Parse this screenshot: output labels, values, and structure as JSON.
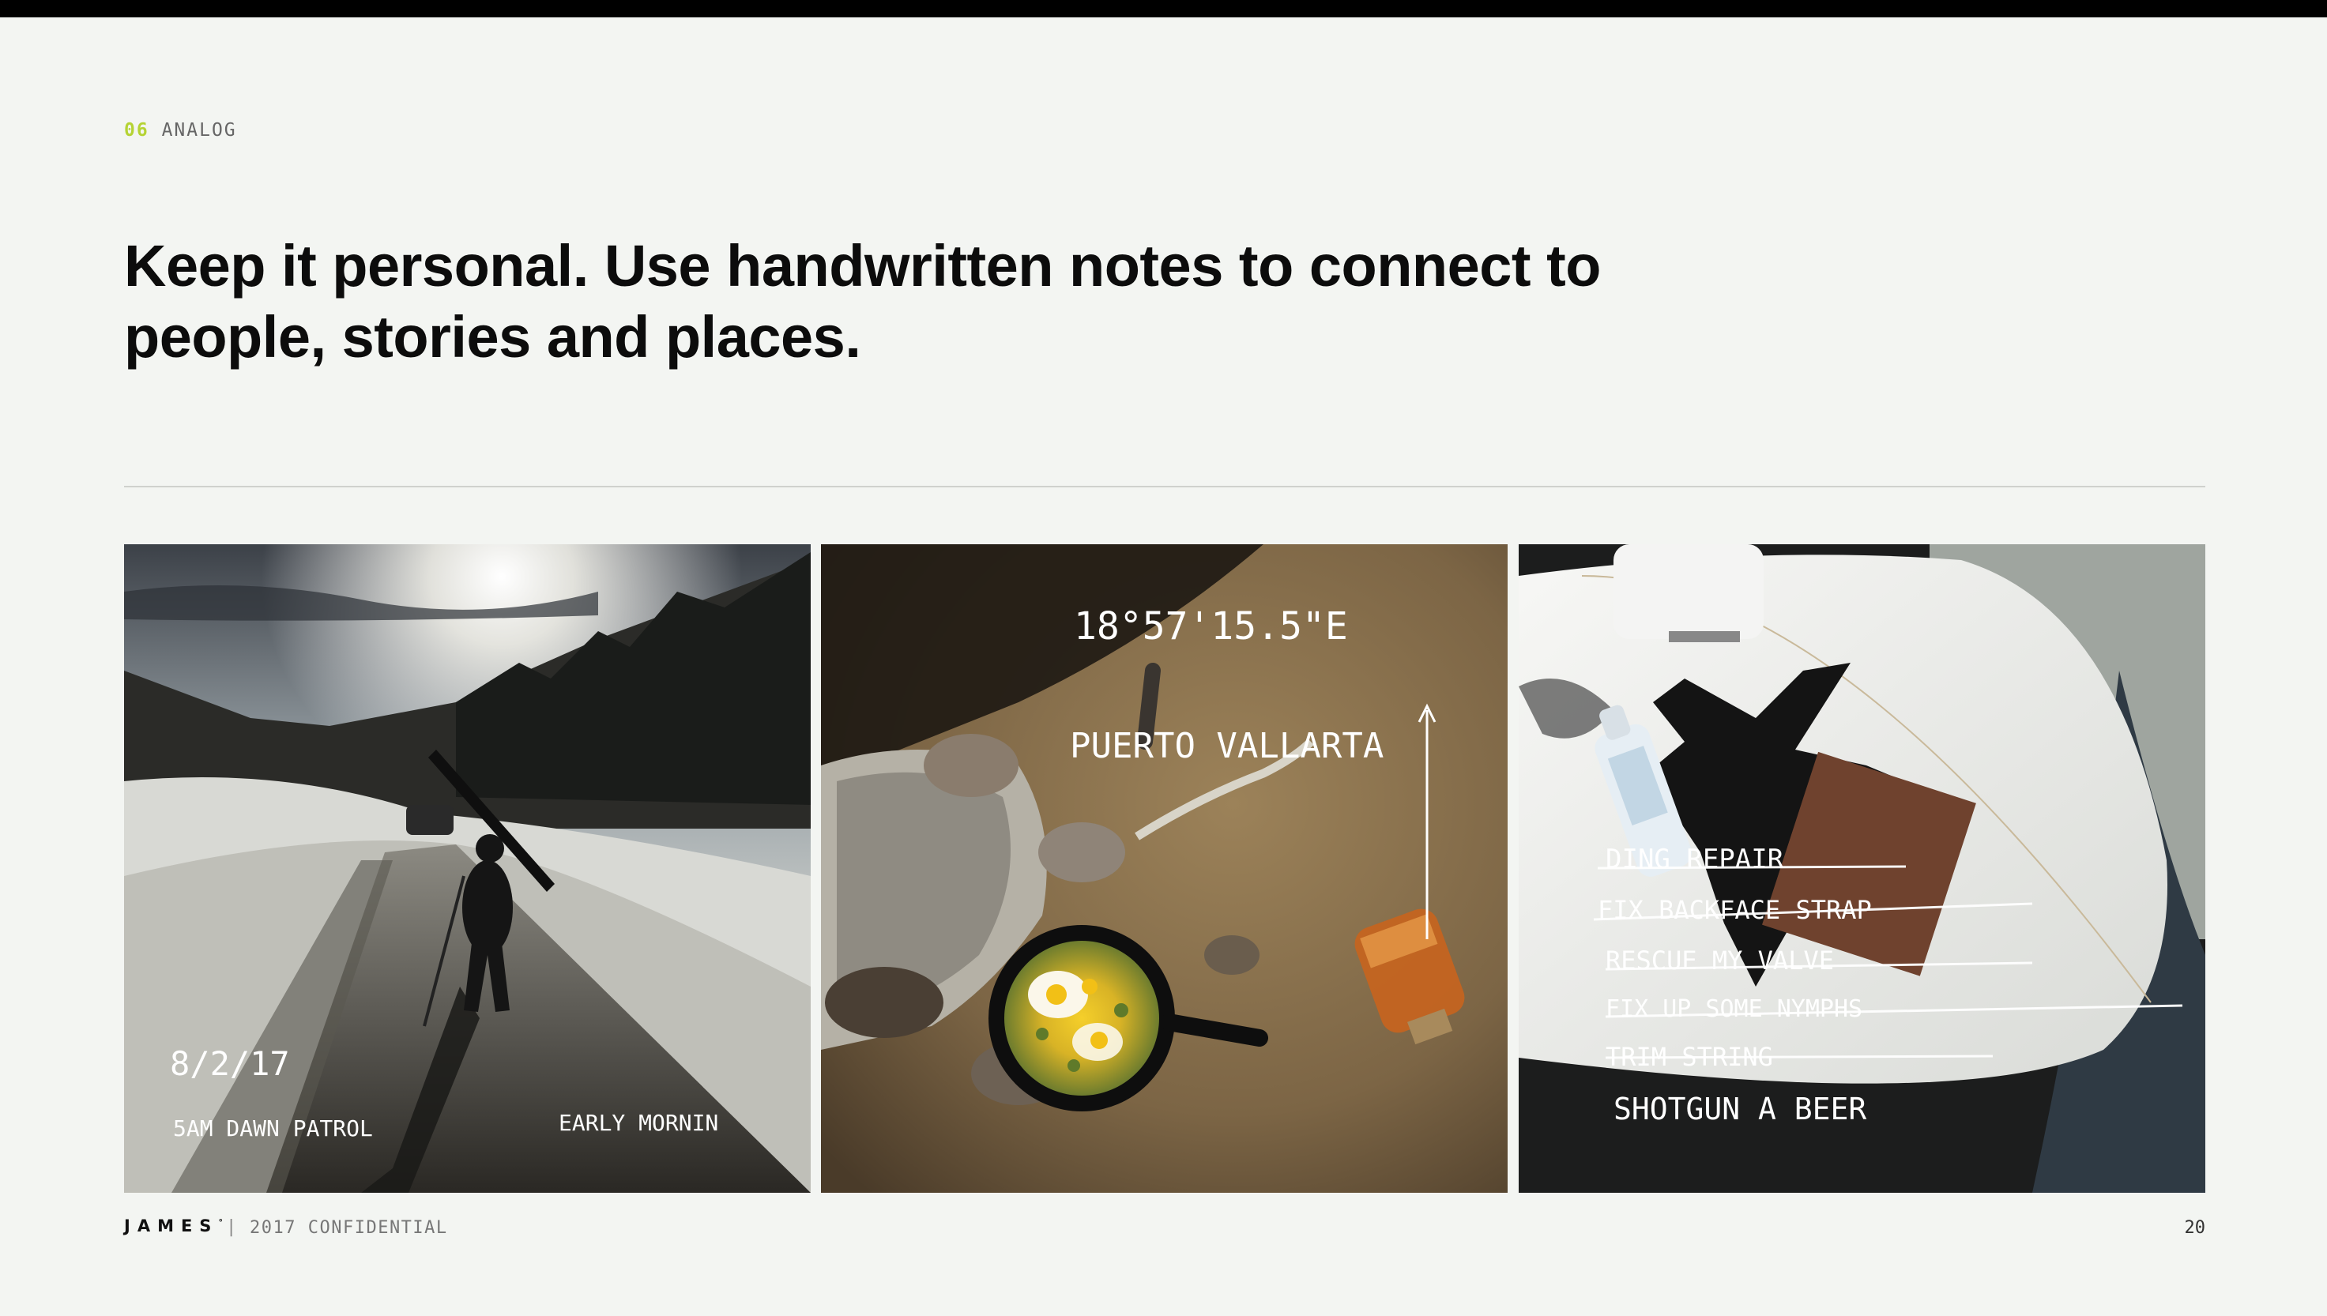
{
  "section": {
    "number": "06",
    "title": "ANALOG"
  },
  "headline": "Keep it personal. Use handwritten notes to connect to people, stories and places.",
  "photos": [
    {
      "subject": "skier walking snowy road at dawn",
      "handwriting": [
        "8/2/17",
        "5AM DAWN PATROL",
        "EARLY MORNIN"
      ]
    },
    {
      "subject": "campfire skillet with eggs",
      "handwriting": [
        "18°57'15.5\"E",
        "PUERTO VALLARTA"
      ]
    },
    {
      "subject": "surfboard repair with sandpaper",
      "handwriting": [
        "DING REPAIR",
        "FIX BACKFACE STRAP",
        "RESCUE MY VALVE",
        "FIX UP SOME NYMPHS",
        "TRIM STRING",
        "SHOTGUN A BEER"
      ]
    }
  ],
  "footer": {
    "brand": "JAMES",
    "brand_mark": "°",
    "separator": "|",
    "confidential": "2017 CONFIDENTIAL",
    "page_number": "20"
  },
  "colors": {
    "accent": "#b5d334",
    "background": "#f3f5f2",
    "text": "#111111",
    "divider": "#cfd1cd"
  }
}
